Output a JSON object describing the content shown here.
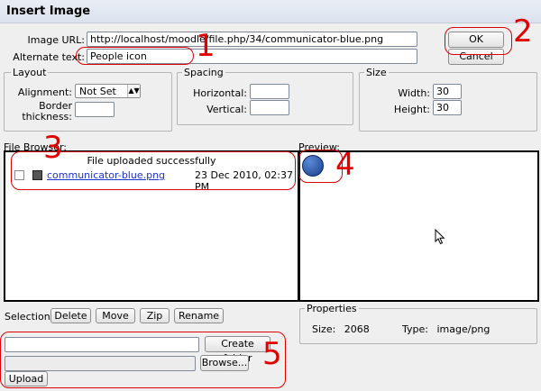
{
  "window": {
    "title": "Insert Image"
  },
  "form": {
    "image_url_label": "Image URL:",
    "image_url_value": "http://localhost/moodle/file.php/34/communicator-blue.png",
    "alt_text_label": "Alternate text:",
    "alt_text_value": "People icon",
    "ok_label": "OK",
    "cancel_label": "Cancel"
  },
  "layout": {
    "legend": "Layout",
    "alignment_label": "Alignment:",
    "alignment_value": "Not Set",
    "border_label_line1": "Border",
    "border_label_line2": "thickness:",
    "border_value": ""
  },
  "spacing": {
    "legend": "Spacing",
    "horizontal_label": "Horizontal:",
    "horizontal_value": "",
    "vertical_label": "Vertical:",
    "vertical_value": ""
  },
  "size": {
    "legend": "Size",
    "width_label": "Width:",
    "width_value": "30",
    "height_label": "Height:",
    "height_value": "30"
  },
  "file_browser": {
    "label": "File Browser:",
    "status": "File uploaded successfully",
    "files": [
      {
        "name": "communicator-blue.png",
        "date": "23 Dec 2010, 02:37 PM"
      }
    ]
  },
  "preview": {
    "label": "Preview:"
  },
  "selection": {
    "label": "Selection:",
    "delete_label": "Delete",
    "move_label": "Move",
    "zip_label": "Zip",
    "rename_label": "Rename"
  },
  "properties": {
    "legend": "Properties",
    "size_label": "Size:",
    "size_value": "2068",
    "type_label": "Type:",
    "type_value": "image/png"
  },
  "upload": {
    "folder_name_value": "",
    "create_folder_label": "Create folder",
    "file_value": "",
    "browse_label": "Browse...",
    "upload_label": "Upload"
  },
  "annotations": [
    "1",
    "2",
    "3",
    "4",
    "5"
  ],
  "colors": {
    "annotation": "#e00000",
    "link": "#1a33cc",
    "titlebar": "#dbe2ee"
  }
}
